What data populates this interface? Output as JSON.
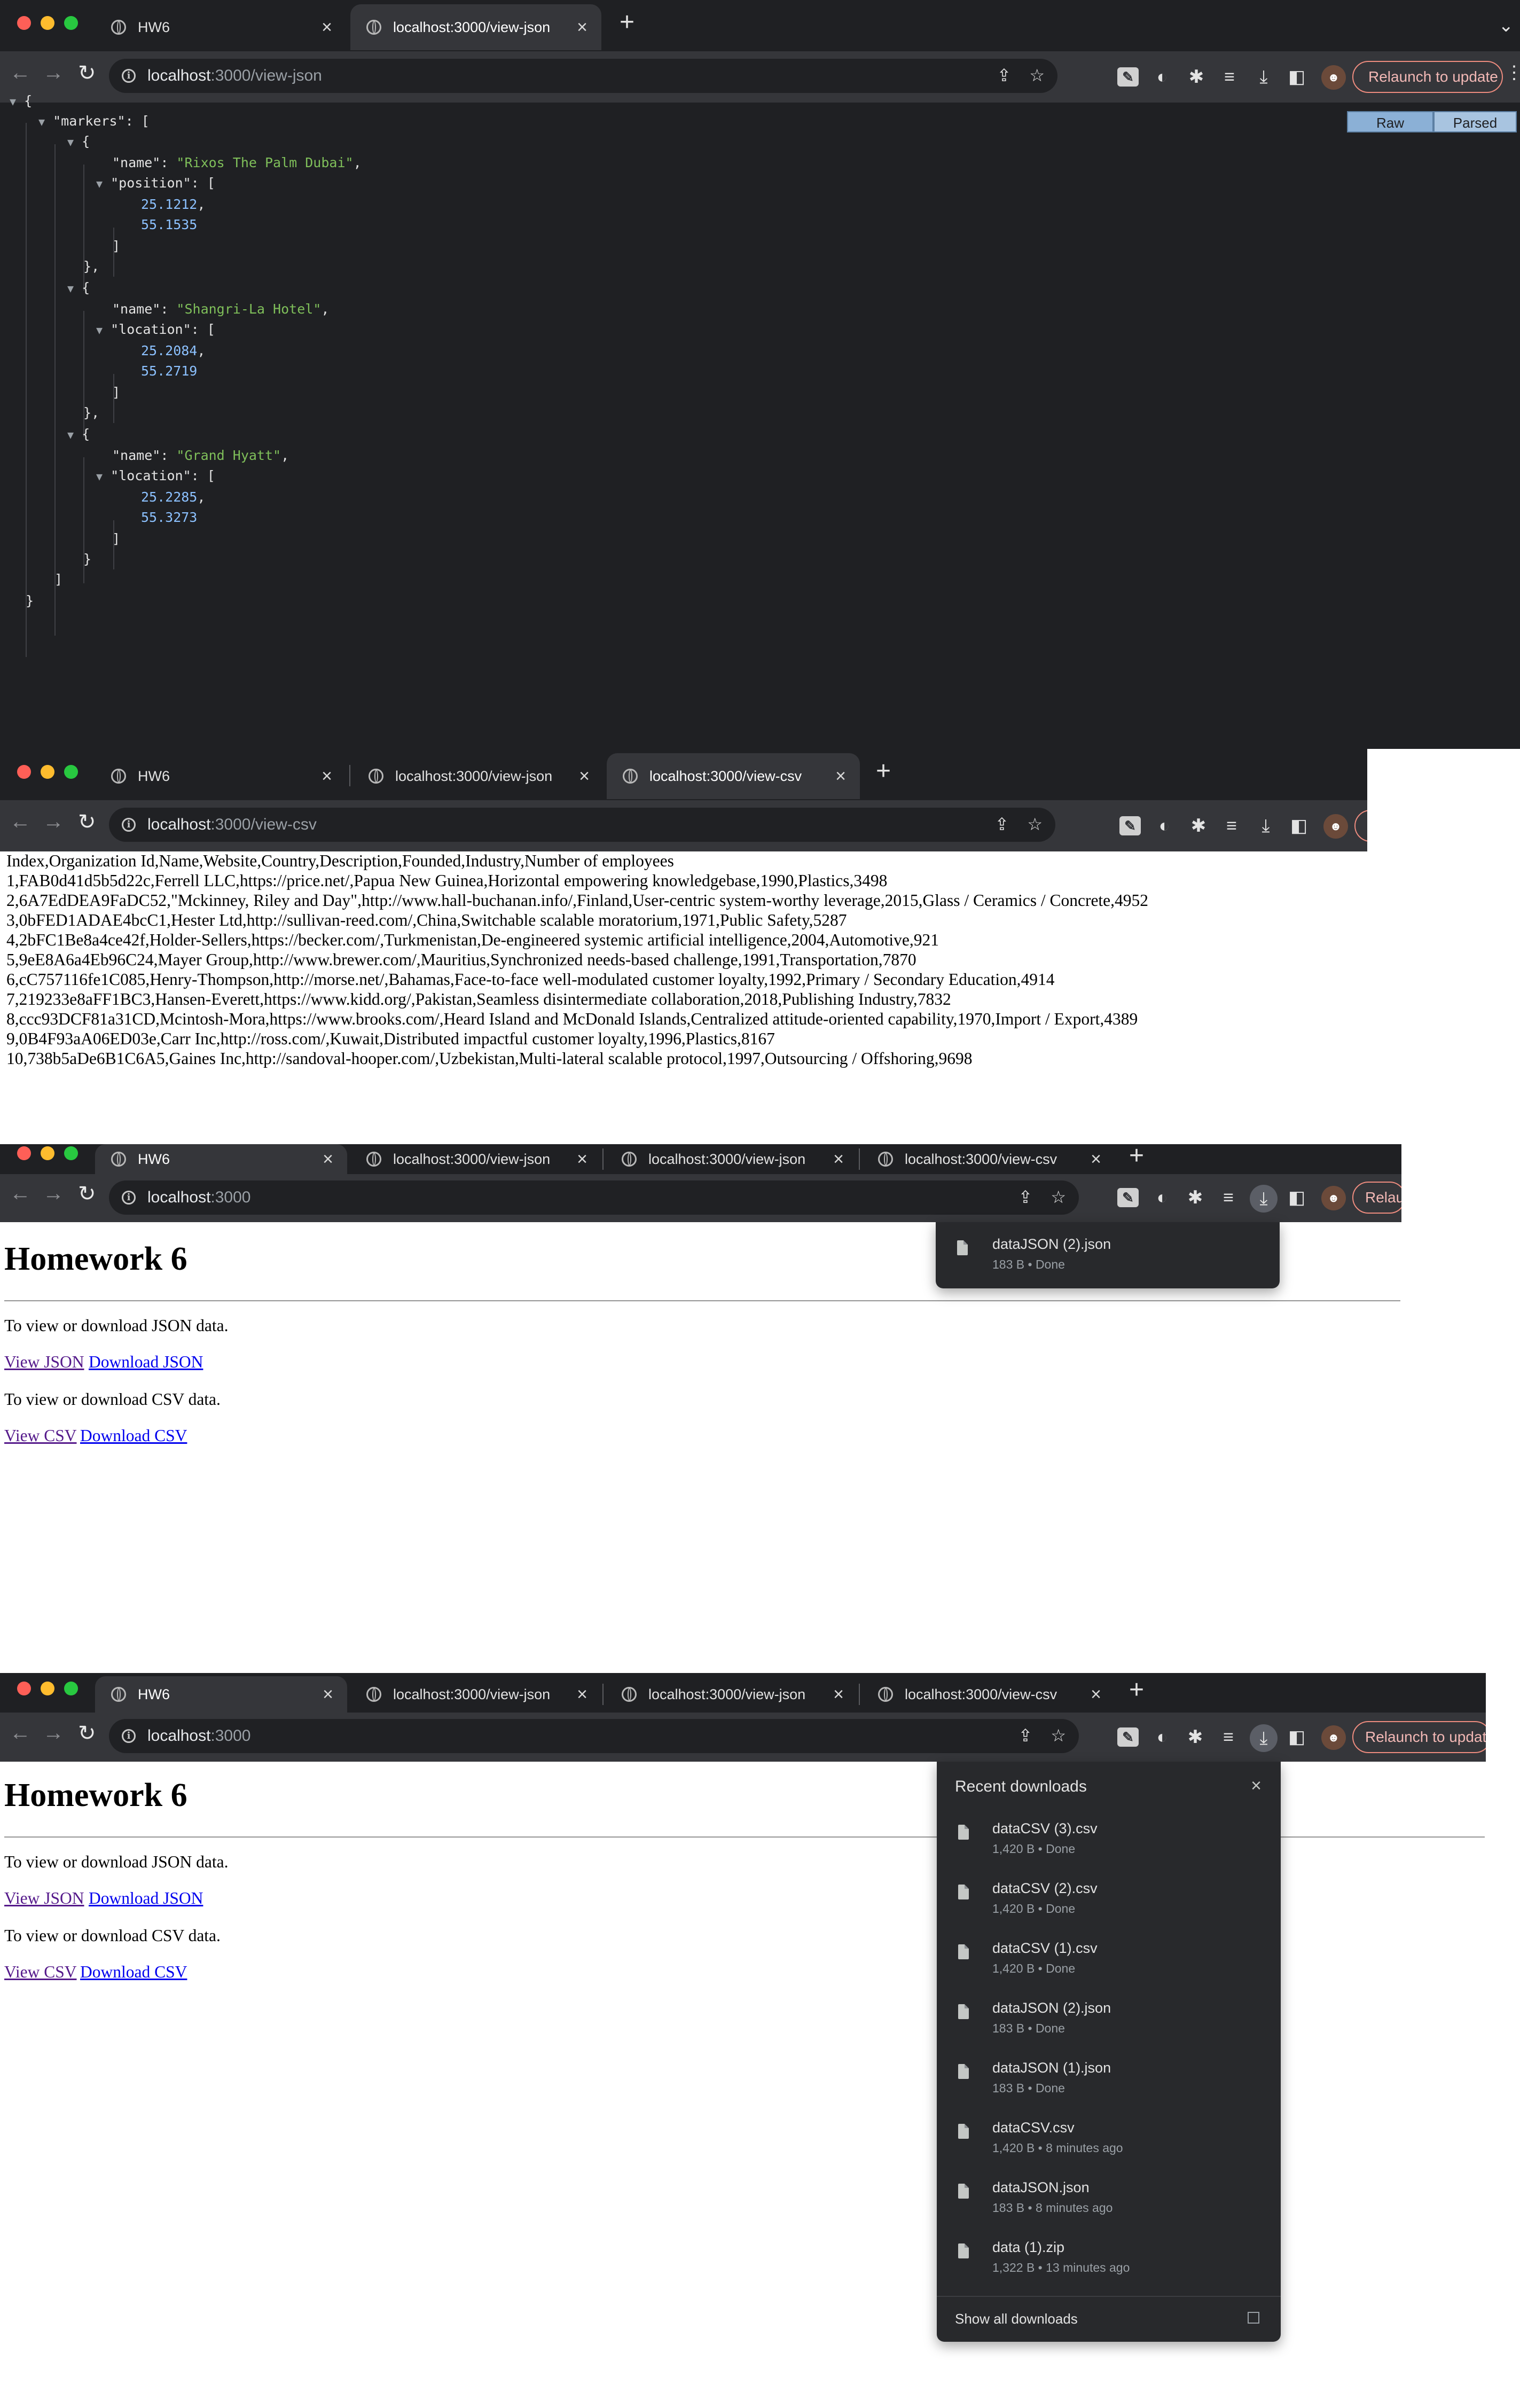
{
  "tabs": {
    "hw6": "HW6",
    "view_json": "localhost:3000/view-json",
    "view_csv": "localhost:3000/view-csv",
    "new_tab": "+",
    "close": "×"
  },
  "omnibox": {
    "json_host": "localhost",
    "json_path": ":3000/view-json",
    "csv_host": "localhost",
    "csv_path": ":3000/view-csv",
    "home_host": "localhost",
    "home_path": ":3000"
  },
  "toolbar": {
    "relaunch_full": "Relaunch to update",
    "relaunch_cut1": "Relau",
    "relaunch_cut2": "Relaunch to updat",
    "back": "←",
    "forward": "→",
    "reload": "↻"
  },
  "json_viewer": {
    "raw_label": "Raw",
    "parsed_label": "Parsed",
    "open_brace": "{",
    "markers_key": "\"markers\"",
    "open_bracket": "[",
    "name_key": "\"name\"",
    "position_key": "\"position\"",
    "location_key": "\"location\"",
    "markers": [
      {
        "name": "\"Rixos The Palm Dubai\"",
        "coords": [
          "25.1212",
          "55.1535"
        ]
      },
      {
        "name": "\"Shangri-La Hotel\"",
        "coords": [
          "25.2084",
          "55.2719"
        ]
      },
      {
        "name": "\"Grand Hyatt\"",
        "coords": [
          "25.2285",
          "55.3273"
        ]
      }
    ],
    "close_brace": "}",
    "close_bracket": "]"
  },
  "csv": {
    "lines": [
      "Index,Organization Id,Name,Website,Country,Description,Founded,Industry,Number of employees",
      "1,FAB0d41d5b5d22c,Ferrell LLC,https://price.net/,Papua New Guinea,Horizontal empowering knowledgebase,1990,Plastics,3498",
      "2,6A7EdDEA9FaDC52,\"Mckinney, Riley and Day\",http://www.hall-buchanan.info/,Finland,User-centric system-worthy leverage,2015,Glass / Ceramics / Concrete,4952",
      "3,0bFED1ADAE4bcC1,Hester Ltd,http://sullivan-reed.com/,China,Switchable scalable moratorium,1971,Public Safety,5287",
      "4,2bFC1Be8a4ce42f,Holder-Sellers,https://becker.com/,Turkmenistan,De-engineered systemic artificial intelligence,2004,Automotive,921",
      "5,9eE8A6a4Eb96C24,Mayer Group,http://www.brewer.com/,Mauritius,Synchronized needs-based challenge,1991,Transportation,7870",
      "6,cC757116fe1C085,Henry-Thompson,http://morse.net/,Bahamas,Face-to-face well-modulated customer loyalty,1992,Primary / Secondary Education,4914",
      "7,219233e8aFF1BC3,Hansen-Everett,https://www.kidd.org/,Pakistan,Seamless disintermediate collaboration,2018,Publishing Industry,7832",
      "8,ccc93DCF81a31CD,Mcintosh-Mora,https://www.brooks.com/,Heard Island and McDonald Islands,Centralized attitude-oriented capability,1970,Import / Export,4389",
      "9,0B4F93aA06ED03e,Carr Inc,http://ross.com/,Kuwait,Distributed impactful customer loyalty,1996,Plastics,8167",
      "10,738b5aDe6B1C6A5,Gaines Inc,http://sandoval-hooper.com/,Uzbekistan,Multi-lateral scalable protocol,1997,Outsourcing / Offshoring,9698"
    ]
  },
  "home": {
    "title": "Homework 6",
    "json_text": "To view or download JSON data.",
    "view_json": "View JSON",
    "download_json": "Download JSON",
    "csv_text": "To view or download CSV data.",
    "view_csv": "View CSV",
    "download_csv": "Download CSV"
  },
  "downloads_small": {
    "name": "dataJSON (2).json",
    "meta": "183 B • Done"
  },
  "downloads": {
    "title": "Recent downloads",
    "close": "×",
    "items": [
      {
        "name": "dataCSV (3).csv",
        "meta": "1,420 B • Done"
      },
      {
        "name": "dataCSV (2).csv",
        "meta": "1,420 B • Done"
      },
      {
        "name": "dataCSV (1).csv",
        "meta": "1,420 B • Done"
      },
      {
        "name": "dataJSON (2).json",
        "meta": "183 B • Done"
      },
      {
        "name": "dataJSON (1).json",
        "meta": "183 B • Done"
      },
      {
        "name": "dataCSV.csv",
        "meta": "1,420 B • 8 minutes ago"
      },
      {
        "name": "dataJSON.json",
        "meta": "183 B • 8 minutes ago"
      },
      {
        "name": "data (1).zip",
        "meta": "1,322 B • 13 minutes ago"
      }
    ],
    "show_all": "Show all downloads"
  },
  "colors": {
    "chrome_dark": "#1f2023",
    "toolbar": "#35363a",
    "json_string": "#7fbf5a",
    "json_number": "#8cc1ff",
    "relaunch_border": "#ee8c7f",
    "link_visited": "#551a8b",
    "link_unvisited": "#0000ee"
  }
}
